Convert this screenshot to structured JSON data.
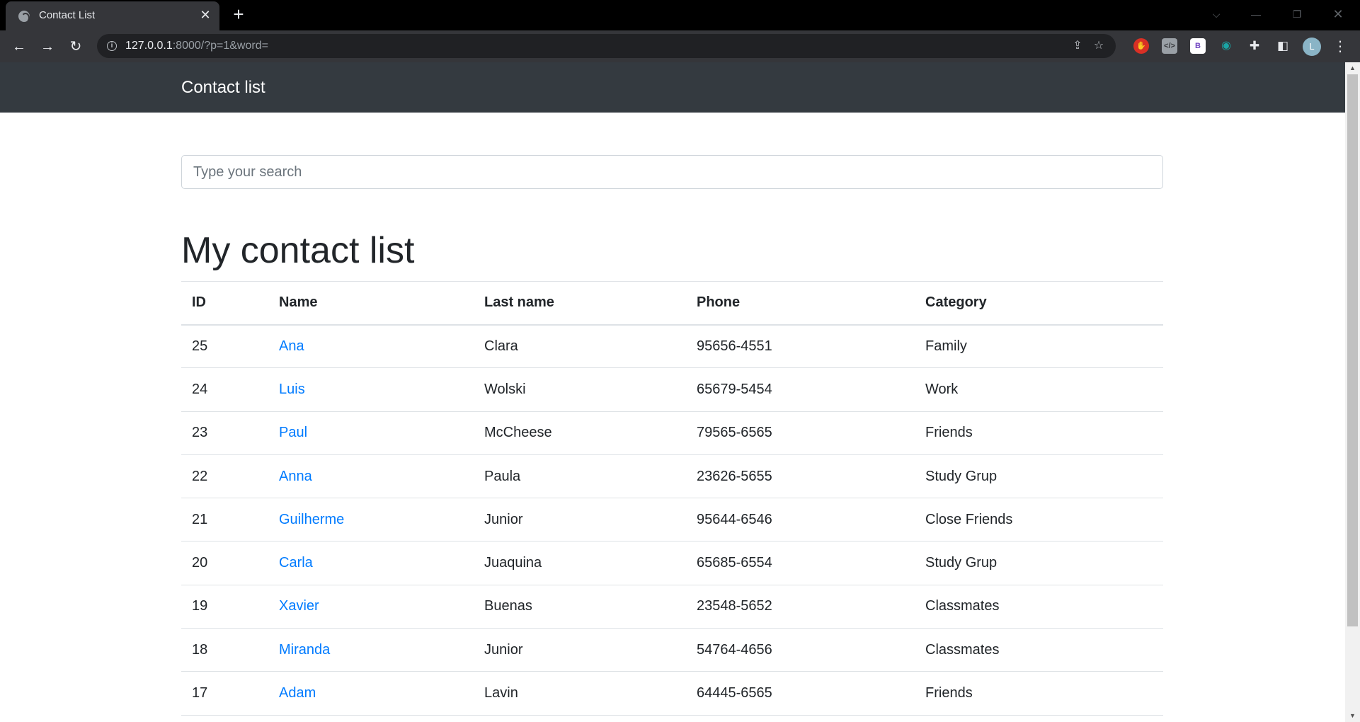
{
  "browser": {
    "tab_title": "Contact List",
    "tab_close": "✕",
    "new_tab": "+",
    "url_host": "127.0.0.1",
    "url_rest": ":8000/?p=1&word=",
    "profile_initial": "L",
    "extensions": [
      "adblock-icon",
      "devtools-icon",
      "bootstrap-icon",
      "vpn-icon"
    ]
  },
  "navbar": {
    "brand": "Contact list"
  },
  "search": {
    "placeholder": "Type your search"
  },
  "main": {
    "title": "My contact list",
    "columns": [
      "ID",
      "Name",
      "Last name",
      "Phone",
      "Category"
    ],
    "rows": [
      {
        "id": "25",
        "name": "Ana",
        "last_name": "Clara",
        "phone": "95656-4551",
        "category": "Family"
      },
      {
        "id": "24",
        "name": "Luis",
        "last_name": "Wolski",
        "phone": "65679-5454",
        "category": "Work"
      },
      {
        "id": "23",
        "name": "Paul",
        "last_name": "McCheese",
        "phone": "79565-6565",
        "category": "Friends"
      },
      {
        "id": "22",
        "name": "Anna",
        "last_name": "Paula",
        "phone": "23626-5655",
        "category": "Study Grup"
      },
      {
        "id": "21",
        "name": "Guilherme",
        "last_name": "Junior",
        "phone": "95644-6546",
        "category": "Close Friends"
      },
      {
        "id": "20",
        "name": "Carla",
        "last_name": "Juaquina",
        "phone": "65685-6554",
        "category": "Study Grup"
      },
      {
        "id": "19",
        "name": "Xavier",
        "last_name": "Buenas",
        "phone": "23548-5652",
        "category": "Classmates"
      },
      {
        "id": "18",
        "name": "Miranda",
        "last_name": "Junior",
        "phone": "54764-4656",
        "category": "Classmates"
      },
      {
        "id": "17",
        "name": "Adam",
        "last_name": "Lavin",
        "phone": "64445-6565",
        "category": "Friends"
      }
    ]
  },
  "colors": {
    "navbar_bg": "#343a40",
    "link": "#007bff",
    "text": "#212529",
    "border": "#dee2e6"
  }
}
